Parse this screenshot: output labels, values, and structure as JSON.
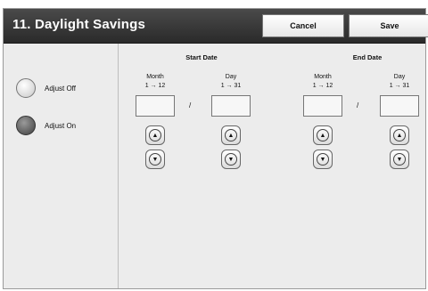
{
  "window": {
    "title": "11. Daylight Savings"
  },
  "header": {
    "cancel_label": "Cancel",
    "save_label": "Save"
  },
  "adjust": {
    "options": [
      {
        "label": "Adjust Off",
        "selected": false
      },
      {
        "label": "Adjust On",
        "selected": true
      }
    ]
  },
  "start_date": {
    "title": "Start Date",
    "month": {
      "label": "Month",
      "range": "1 → 12",
      "value": ""
    },
    "separator": "/",
    "day": {
      "label": "Day",
      "range": "1 → 31",
      "value": ""
    }
  },
  "end_date": {
    "title": "End Date",
    "month": {
      "label": "Month",
      "range": "1 → 12",
      "value": ""
    },
    "separator": "/",
    "day": {
      "label": "Day",
      "range": "1 → 31",
      "value": ""
    }
  },
  "icons": {
    "up": "▲",
    "down": "▼"
  }
}
